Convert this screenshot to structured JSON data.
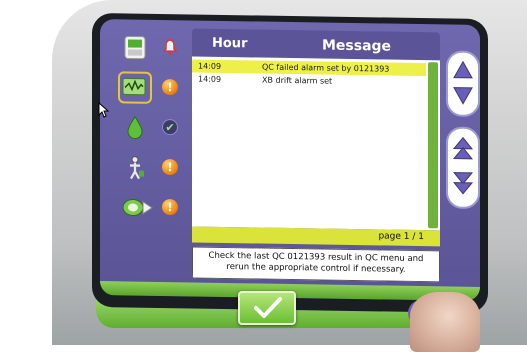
{
  "table": {
    "col_hour": "Hour",
    "col_message": "Message",
    "rows": [
      {
        "time": "14:09",
        "message": "QC failed alarm set by 0121393",
        "highlighted": true
      },
      {
        "time": "14:09",
        "message": "XB drift alarm set",
        "highlighted": false
      }
    ]
  },
  "pagination": {
    "label": "page 1 / 1"
  },
  "help_text": "Check the last QC 0121393 result in QC menu and rerun the appropriate control if necessary.",
  "sidebar": {
    "items": [
      {
        "icon": "analyzer-icon",
        "status": "alarm-bell-icon"
      },
      {
        "icon": "waveform-monitor-icon",
        "status": "warning-icon",
        "selected": true
      },
      {
        "icon": "reagent-drop-icon",
        "status": "ok-check-icon"
      },
      {
        "icon": "maintenance-person-icon",
        "status": "warning-icon"
      },
      {
        "icon": "sample-tube-icon",
        "status": "warning-icon"
      }
    ]
  },
  "colors": {
    "panel": "#5a5496",
    "highlight": "#eef04a",
    "accent_green": "#6cbf33",
    "warning": "#f08a16"
  }
}
